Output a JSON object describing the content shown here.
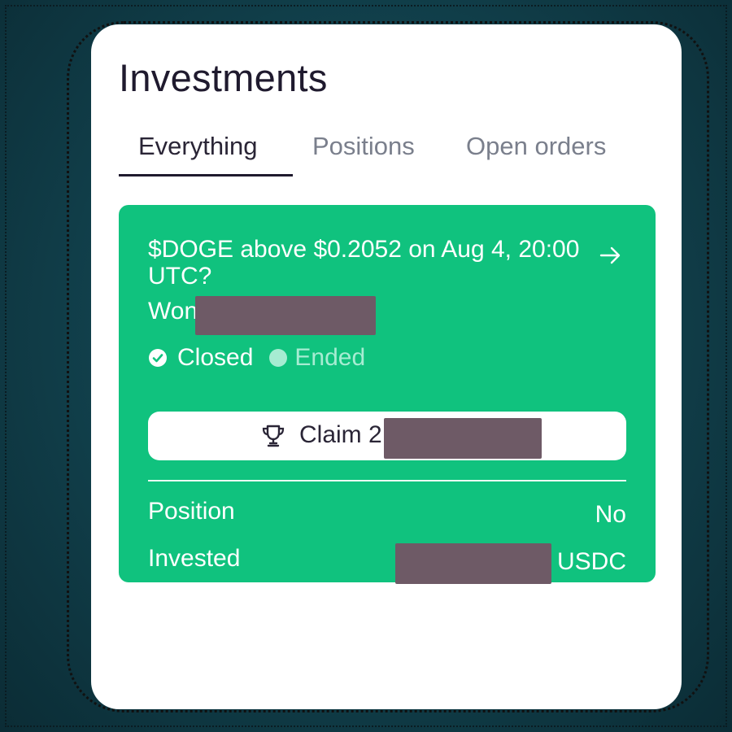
{
  "page": {
    "title": "Investments"
  },
  "tabs": [
    {
      "label": "Everything",
      "active": true
    },
    {
      "label": "Positions",
      "active": false
    },
    {
      "label": "Open orders",
      "active": false
    }
  ],
  "card": {
    "question": "$DOGE above $0.2052 on Aug 4, 20:00 UTC?",
    "arrow_icon": "arrow-right-icon",
    "won_text": "Won 2",
    "status": {
      "closed_label": "Closed",
      "closed_icon": "check-circle-icon",
      "ended_label": "Ended"
    },
    "claim": {
      "label": "Claim 2",
      "icon": "trophy-icon"
    },
    "position": {
      "label": "Position",
      "value": "No"
    },
    "invested": {
      "label": "Invested",
      "unit": "USDC"
    }
  },
  "colors": {
    "card_green": "#10c27e",
    "ended_mint": "#a6ecd2",
    "redaction": "#6e5a66",
    "background": "#12434f"
  }
}
